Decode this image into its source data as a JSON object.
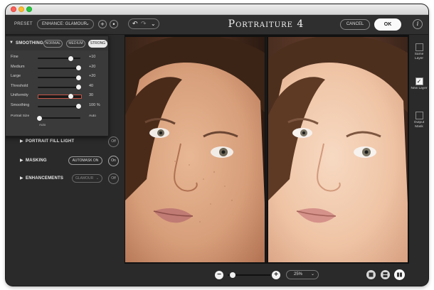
{
  "window": {
    "app_title": "Portraiture 4",
    "controls": [
      "close-dot",
      "minimize-dot",
      "zoom-dot"
    ]
  },
  "toolbar": {
    "preset_label": "PRESET",
    "preset_value": "ENHANCE: GLAMOUR",
    "add_preset_glyph": "+",
    "preset_options_glyph": "•",
    "undo_glyph": "↶",
    "redo_glyph": "↷",
    "history_glyph": "⌄",
    "cancel_label": "CANCEL",
    "ok_label": "OK",
    "info_glyph": "i"
  },
  "smoothing": {
    "title": "SMOOTHING",
    "modes": [
      "NORMAL",
      "MEDIUM",
      "STRONG"
    ],
    "active_mode": "STRONG",
    "sliders": [
      {
        "name": "Fine",
        "value": "+10",
        "level": 0.78
      },
      {
        "name": "Medium",
        "value": "+20",
        "level": 0.96
      },
      {
        "name": "Large",
        "value": "+20",
        "level": 0.96
      },
      {
        "name": "Threshold",
        "value": "40",
        "level": 0.96
      },
      {
        "name": "Uniformity",
        "value": "30",
        "level": 0.78,
        "highlighted": true
      },
      {
        "name": "Smoothing",
        "value": "100 %",
        "level": 0.96
      }
    ],
    "portrait_size": {
      "label": "Portrait Size",
      "value": "Auto",
      "sub": "Auto",
      "level": 0.0
    }
  },
  "sections": [
    {
      "title": "PORTRAIT FILL LIGHT",
      "toggle": "Off"
    },
    {
      "title": "MASKING",
      "chip": "AUTOMASK ON",
      "toggle": "On"
    },
    {
      "title": "ENHANCEMENTS",
      "chip": "GLAMOUR",
      "toggle": "Off"
    }
  ],
  "layers": [
    {
      "label": "Same Layer",
      "checked": false
    },
    {
      "label": "New Layer",
      "checked": true
    },
    {
      "label": "Output Mask",
      "checked": false
    }
  ],
  "bottom": {
    "zoom_out_glyph": "−",
    "zoom_in_glyph": "+",
    "zoom_level": "25%",
    "zoom_slider_level": 0.08,
    "view_modes": [
      "single-view",
      "split-horizontal",
      "split-vertical"
    ],
    "active_view": "split-vertical"
  },
  "colors": {
    "accent_highlight": "#c8584a",
    "panel_bg": "#2a2a2a"
  }
}
